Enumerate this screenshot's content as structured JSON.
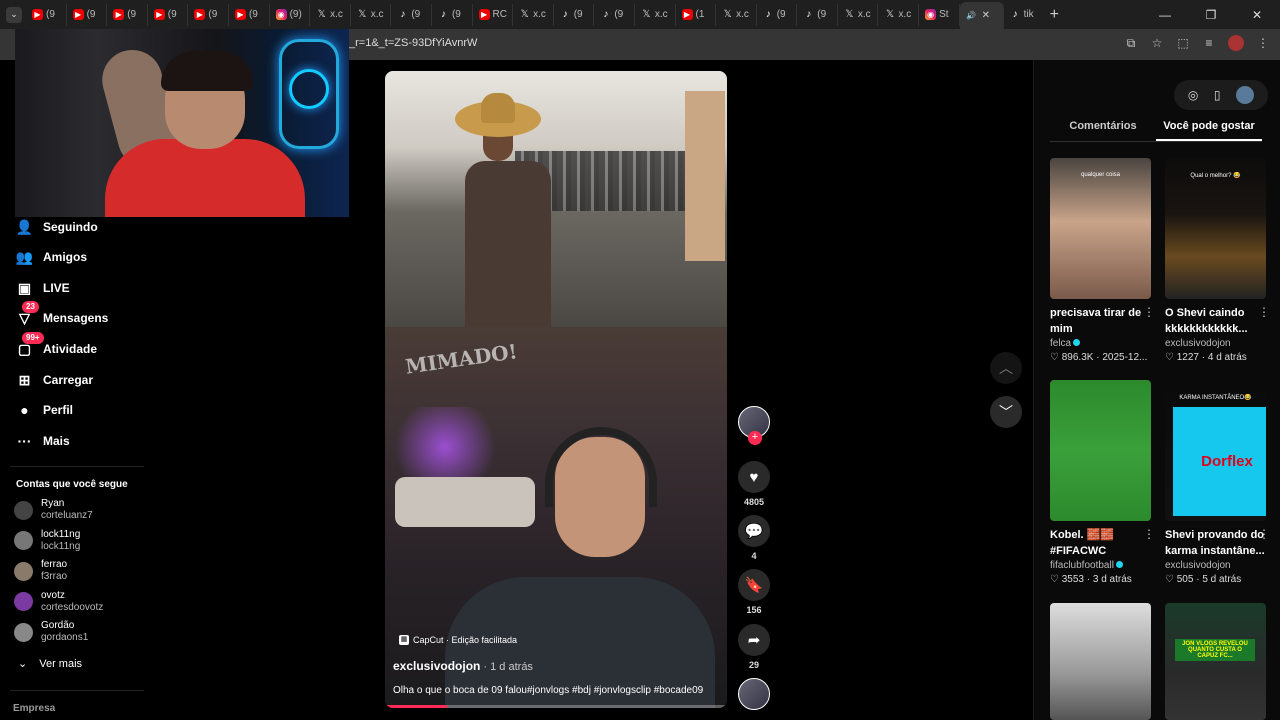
{
  "browser": {
    "tabs": [
      {
        "icon": "yt",
        "label": "(9"
      },
      {
        "icon": "yt",
        "label": "(9"
      },
      {
        "icon": "yt",
        "label": "(9"
      },
      {
        "icon": "yt",
        "label": "(9"
      },
      {
        "icon": "yt",
        "label": "(9"
      },
      {
        "icon": "yt",
        "label": "(9"
      },
      {
        "icon": "ig",
        "label": "(9)"
      },
      {
        "icon": "x",
        "label": "x.c"
      },
      {
        "icon": "x",
        "label": "x.c"
      },
      {
        "icon": "tt",
        "label": "(9"
      },
      {
        "icon": "tt",
        "label": "(9"
      },
      {
        "icon": "yt",
        "label": "RC"
      },
      {
        "icon": "x",
        "label": "x.c"
      },
      {
        "icon": "tt",
        "label": "(9"
      },
      {
        "icon": "tt",
        "label": "(9"
      },
      {
        "icon": "x",
        "label": "x.c"
      },
      {
        "icon": "yt",
        "label": "(1"
      },
      {
        "icon": "x",
        "label": "x.c"
      },
      {
        "icon": "tt",
        "label": "(9"
      },
      {
        "icon": "tt",
        "label": "(9"
      },
      {
        "icon": "x",
        "label": "x.c"
      },
      {
        "icon": "x",
        "label": "x.c"
      },
      {
        "icon": "ig",
        "label": "St"
      }
    ],
    "active_tab_label": "",
    "last_tab_label": "tik",
    "url": "_r=1&_t=ZS-93DfYiAvnrW"
  },
  "sidebar": {
    "nav": [
      {
        "icon": "following-icon",
        "glyph": "👤",
        "label": "Seguindo",
        "badge": ""
      },
      {
        "icon": "friends-icon",
        "glyph": "👥",
        "label": "Amigos",
        "badge": ""
      },
      {
        "icon": "live-icon",
        "glyph": "▣",
        "label": "LIVE",
        "badge": ""
      },
      {
        "icon": "messages-icon",
        "glyph": "▽",
        "label": "Mensagens",
        "badge": "23"
      },
      {
        "icon": "activity-icon",
        "glyph": "▢",
        "label": "Atividade",
        "badge": "99+"
      },
      {
        "icon": "upload-icon",
        "glyph": "⊞",
        "label": "Carregar",
        "badge": ""
      },
      {
        "icon": "profile-icon",
        "glyph": "●",
        "label": "Perfil",
        "badge": ""
      },
      {
        "icon": "more-icon",
        "glyph": "···",
        "label": "Mais",
        "badge": ""
      }
    ],
    "following_title": "Contas que você segue",
    "following": [
      {
        "name": "Ryan",
        "handle": "corteluanz7"
      },
      {
        "name": "lock11ng",
        "handle": "lock11ng"
      },
      {
        "name": "ferrao",
        "handle": "f3rrao"
      },
      {
        "name": "ovotz",
        "handle": "cortesdoovotz"
      },
      {
        "name": "Gordão",
        "handle": "gordaons1"
      }
    ],
    "see_more": "Ver mais",
    "company": "Empresa"
  },
  "video": {
    "wall_text": "MIMADO!",
    "capcut_label": "CapCut · Edição facilitada",
    "author": "exclusivodojon",
    "time": " · 1 d atrás",
    "caption": "Olha o que o boca de 09 falou#jonvlogs #bdj #jonvlogsclip #bocade09",
    "progress": 0.18
  },
  "actions": {
    "likes": "4805",
    "comments": "4",
    "saves": "156",
    "shares": "29"
  },
  "right_panel": {
    "tabs": [
      "Comentários",
      "Você pode gostar"
    ],
    "active_tab": 1,
    "cards": [
      {
        "thumb_text": "qualquer coisa",
        "title": "precisava tirar de mim",
        "author": "felca",
        "verified": true,
        "meta": "♡ 896.3K · 2025-12..."
      },
      {
        "thumb_text": "Qual o melhor? 😂",
        "title": "O Shevi caindo kkkkkkkkkkkk...",
        "author": "exclusivodojon",
        "verified": false,
        "meta": "♡ 1227 · 4 d atrás"
      },
      {
        "thumb_text": "",
        "title": "Kobel. 🧱🧱 #FIFACWC",
        "author": "fifaclubfootball",
        "verified": true,
        "meta": "♡ 3553 · 3 d atrás"
      },
      {
        "thumb_text": "KARMA INSTANTÂNEO😂",
        "title": "Shevi provando do karma instantâne...",
        "author": "exclusivodojon",
        "verified": false,
        "meta": "♡ 505 · 5 d atrás"
      }
    ],
    "dorflex_text": "Dorflex",
    "jon_banner": "JON VLOGS REVELOU QUANTO CUSTA O CAPUZ FC..."
  }
}
